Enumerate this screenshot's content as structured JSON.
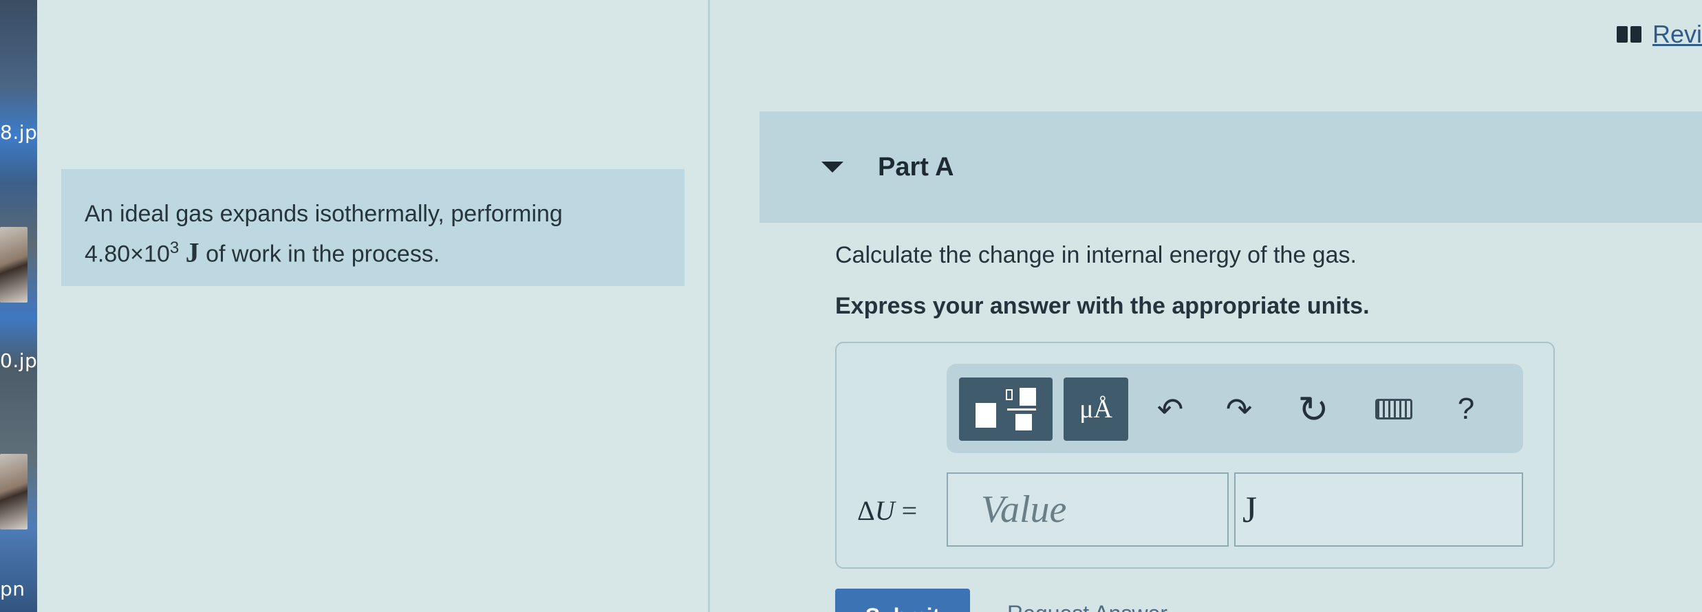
{
  "desktop": {
    "files": [
      {
        "label": "8.jp"
      },
      {
        "label": "0.jp"
      },
      {
        "label": "pn"
      }
    ]
  },
  "header": {
    "review_label": "Revi"
  },
  "problem": {
    "line1": "An ideal gas expands isothermally, performing",
    "work_mantissa": "4.80×10",
    "work_exponent": "3",
    "work_unit": "J",
    "line2_rest": " of work in the process."
  },
  "part": {
    "title": "Part A",
    "question": "Calculate the change in internal energy of the gas.",
    "instruction": "Express your answer with the appropriate units."
  },
  "toolbar": {
    "units_label": "μÅ",
    "undo_glyph": "↶",
    "redo_glyph": "↷",
    "reset_glyph": "↻",
    "help_label": "?"
  },
  "answer": {
    "variable_symbol": "U",
    "variable_prefix": "Δ",
    "equals": " =",
    "value_placeholder": "Value",
    "units_value": "J"
  },
  "actions": {
    "submit_label": "Submit",
    "request_label": "Request Answer"
  },
  "colors": {
    "accent": "#3c73b4",
    "panel": "#bcd5dd",
    "toolbar_button": "#3f5b6c"
  }
}
